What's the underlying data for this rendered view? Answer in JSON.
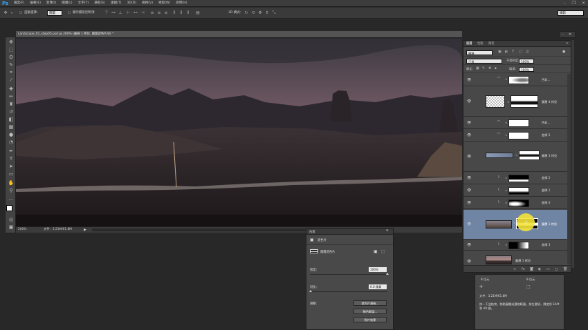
{
  "app": {
    "logo": "Ps"
  },
  "menu": {
    "items": [
      "檔案(F)",
      "編輯(E)",
      "影像(I)",
      "圖層(L)",
      "文字(Y)",
      "選取(S)",
      "濾鏡(T)",
      "3D(D)",
      "檢視(V)",
      "視窗(W)",
      "說明(H)"
    ],
    "win_controls": [
      "–",
      "❐",
      "✕"
    ]
  },
  "options": {
    "auto_select_label": "自動選擇：",
    "auto_select_value": "圖層",
    "show_transform_label": "顯示變形控制項",
    "mode_3d_label": "3D 模式：",
    "workspace_value": "攝影"
  },
  "document": {
    "tab_title": "Landscape_01_step05.psd @ 200% (曲線 1 拷貝, 圖層遮色片/8) *",
    "zoom": "200%",
    "file_info": "文件：3.21M/61.8M"
  },
  "layers_panel": {
    "tabs": [
      "圖層",
      "色版",
      "路徑"
    ],
    "kind_label": "種類",
    "blend_mode": "正常",
    "opacity_label": "不透明度：",
    "opacity_value": "100%",
    "lock_label": "鎖定：",
    "fill_label": "填滿：",
    "fill_value": "100%",
    "layers": [
      {
        "name": "色彩...",
        "type": "adjustment",
        "selected": false
      },
      {
        "name": "圖層 4 拷貝",
        "type": "masked",
        "selected": false
      },
      {
        "name": "色彩...",
        "type": "adjustment",
        "selected": false
      },
      {
        "name": "曲線 5",
        "type": "adjustment",
        "selected": false
      },
      {
        "name": "圖層 3 拷貝",
        "type": "masked",
        "selected": false
      },
      {
        "name": "曲線 2",
        "type": "adjustment",
        "selected": false
      },
      {
        "name": "曲線 1",
        "type": "adjustment",
        "selected": false
      },
      {
        "name": "曲線 4",
        "type": "adjustment",
        "selected": false
      },
      {
        "name": "圖層 1 拷貝",
        "type": "masked",
        "selected": true
      },
      {
        "name": "曲線 3",
        "type": "adjustment",
        "selected": false
      },
      {
        "name": "圖層 1 拷貝",
        "type": "pixel",
        "selected": false
      }
    ],
    "footer_icons": [
      "link-icon",
      "fx-icon",
      "mask-icon",
      "adjustment-icon",
      "group-icon",
      "new-layer-icon",
      "trash-icon"
    ]
  },
  "info_panel": {
    "bit_left": "8 位元",
    "bit_right": "8 位元",
    "doc_info": "文件：3.21M/61.8M",
    "hint": "按一下並拖曳，移動圖層或選取範圍。按住選項，請使用 Shift 和 Alt 鍵。"
  },
  "properties_panel": {
    "tab": "內容",
    "title": "遮色片",
    "mask_label": "圖層遮色片",
    "density_label": "密度：",
    "density_value": "100%",
    "feather_label": "羽化：",
    "feather_value": "0.0 像素",
    "refine_label": "調整：",
    "btn_mask_edge": "遮色片邊緣...",
    "btn_color_range": "顏色範圍...",
    "btn_invert": "負片效果"
  },
  "colors": {
    "accent": "#31a8ff",
    "selected_layer": "#6f85a3",
    "highlight": "#f4e23a"
  }
}
